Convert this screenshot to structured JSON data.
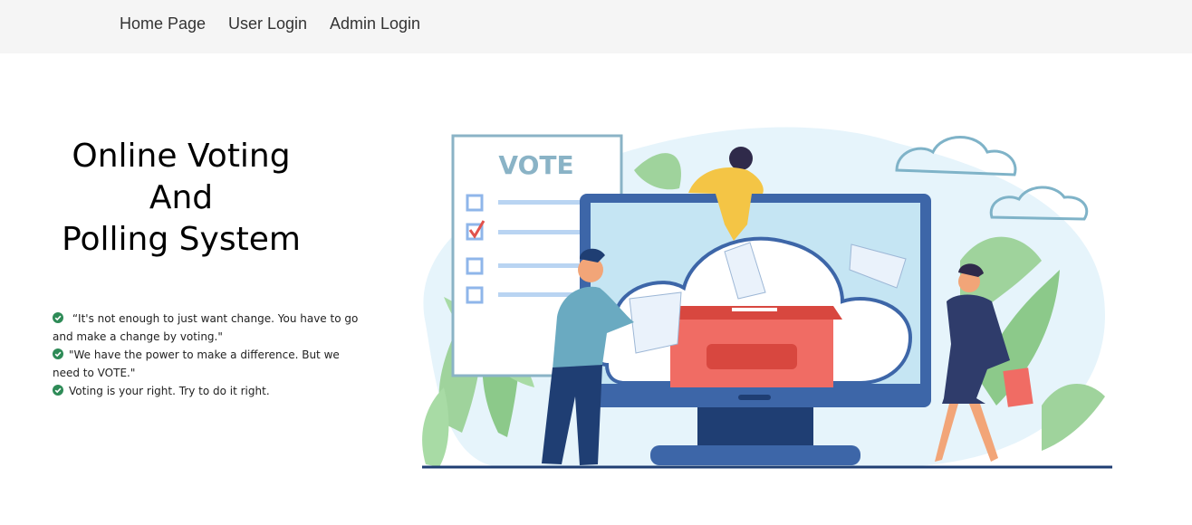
{
  "nav": {
    "items": [
      {
        "label": "Home Page"
      },
      {
        "label": "User Login"
      },
      {
        "label": "Admin Login"
      }
    ]
  },
  "hero": {
    "title_lines": [
      "Online Voting",
      "And",
      "Polling System"
    ],
    "quotes": [
      " “It's not enough to just want change. You have to go and make a change by voting.\"",
      "\"We have the power to make a difference. But we need to VOTE.\"",
      "Voting is your right. Try to do it right."
    ]
  },
  "illustration": {
    "ballot_heading": "VOTE"
  },
  "colors": {
    "navbar_bg": "#f5f5f5",
    "check_green": "#2e8b57",
    "monitor_blue": "#3d66a8",
    "ballot_box_red": "#f06c64"
  }
}
